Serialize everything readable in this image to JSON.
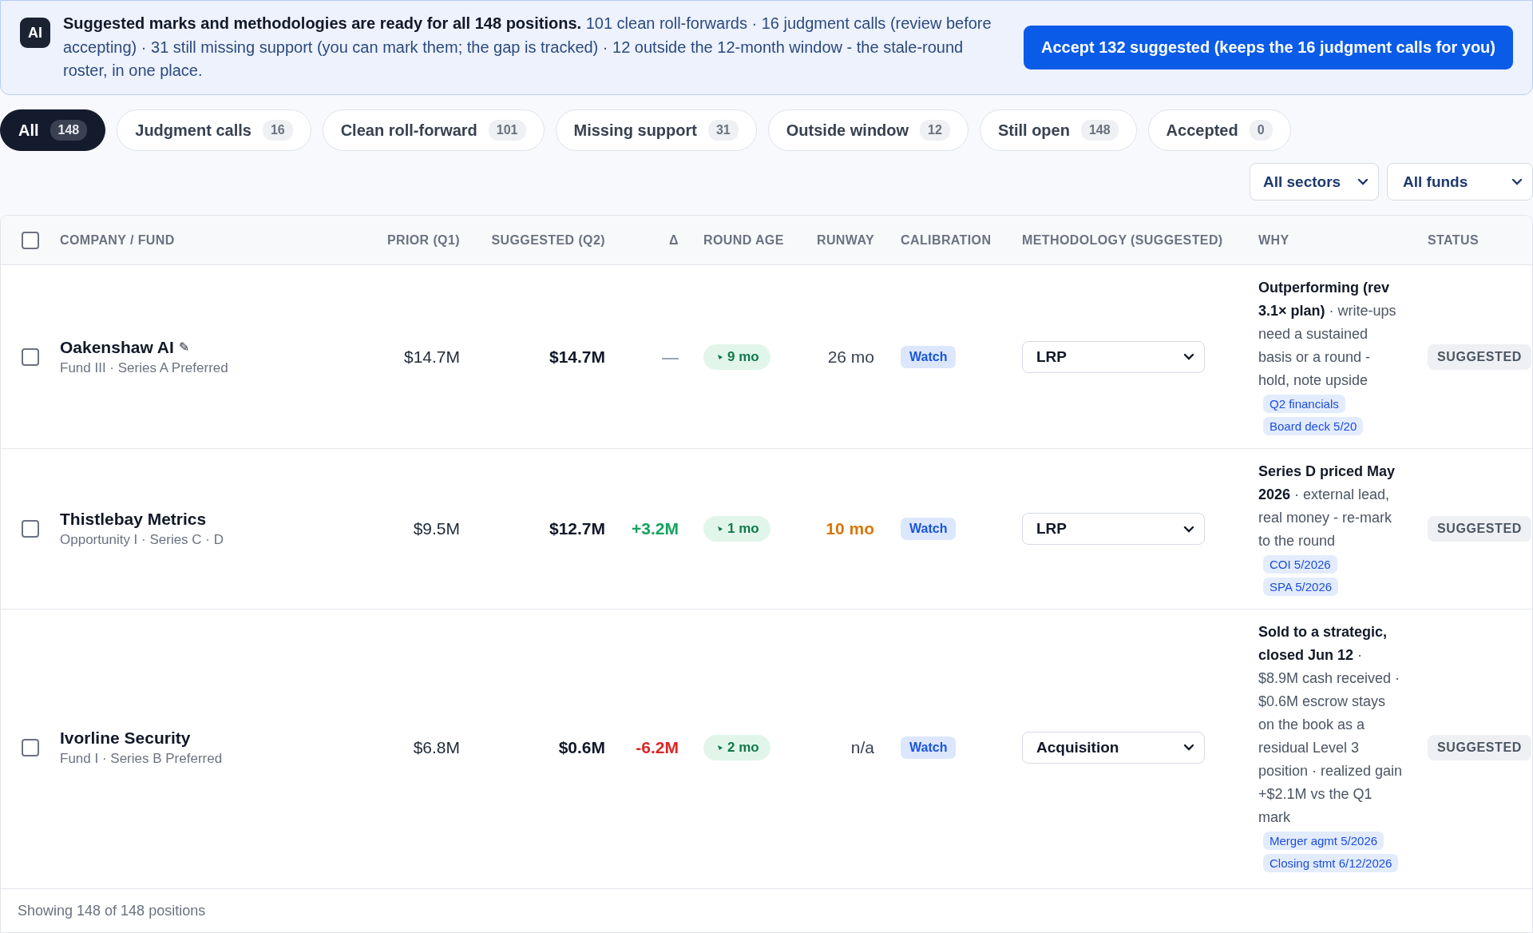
{
  "banner": {
    "badge": "AI",
    "message": "**Suggested marks and methodologies are ready for all 148 positions.** 101 clean roll-forwards · 16 judgment calls (review before accepting) · 31 still missing support (you can mark them; the gap is tracked) · 12 outside the 12-month window - the stale-round roster, in one place.",
    "action": "Accept 132 suggested (keeps the 16 judgment calls for you)"
  },
  "tabs": [
    {
      "label": "All",
      "count": "148",
      "selected": true
    },
    {
      "label": "Judgment calls",
      "count": "16",
      "selected": false
    },
    {
      "label": "Clean roll-forward",
      "count": "101",
      "selected": false
    },
    {
      "label": "Missing support",
      "count": "31",
      "selected": false
    },
    {
      "label": "Outside window",
      "count": "12",
      "selected": false
    },
    {
      "label": "Still open",
      "count": "148",
      "selected": false
    },
    {
      "label": "Accepted",
      "count": "0",
      "selected": false
    }
  ],
  "filters": [
    "All sectors",
    "All funds"
  ],
  "table": {
    "select_all_checked": false,
    "columns": [
      "COMPANY / FUND",
      "PRIOR (Q1)",
      "SUGGESTED (Q2)",
      "Δ",
      "ROUND AGE",
      "RUNWAY",
      "CALIBRATION",
      "METHODOLOGY (SUGGESTED)",
      "WHY",
      "STATUS"
    ],
    "rows": [
      {
        "checked": false,
        "name": "Oakenshaw AI",
        "edit_mark": "✎",
        "detail": "Fund III · Series A Preferred",
        "prior": "$14.7M",
        "suggested": "$14.7M",
        "delta": {
          "text": "—",
          "color": "#9ca3af"
        },
        "round_age": "9 mo",
        "runway": "26 mo",
        "runway_warning": false,
        "calibration": "Watch",
        "methodology": "LRP",
        "why": "**Outperforming (rev 3.1× plan)** · write-ups need a sustained basis or a round - hold, note upside",
        "evidence": [
          "Q2 financials",
          "Board deck 5/20"
        ],
        "status": "SUGGESTED"
      },
      {
        "checked": false,
        "name": "Thistlebay Metrics",
        "detail": "Opportunity I · Series C · D",
        "prior": "$9.5M",
        "suggested": "$12.7M",
        "delta": {
          "text": "+3.2M",
          "color": "#16a35f"
        },
        "round_age": "1 mo",
        "runway": "10 mo",
        "runway_warning": true,
        "calibration": "Watch",
        "methodology": "LRP",
        "why": "**Series D priced May 2026** · external lead, real money - re-mark to the round",
        "evidence": [
          "COI 5/2026",
          "SPA 5/2026"
        ],
        "status": "SUGGESTED"
      },
      {
        "checked": false,
        "name": "Ivorline Security",
        "detail": "Fund I · Series B Preferred",
        "prior": "$6.8M",
        "suggested": "$0.6M",
        "delta": {
          "text": "-6.2M",
          "color": "#dc2626"
        },
        "round_age": "2 mo",
        "runway": "n/a",
        "runway_warning": false,
        "calibration": "Watch",
        "methodology": "Acquisition",
        "why": "**Sold to a strategic, closed Jun 12** · $8.9M cash received · $0.6M escrow stays on the book as a residual Level 3 position · realized gain +$2.1M vs the Q1 mark",
        "evidence": [
          "Merger agmt 5/2026",
          "Closing stmt 6/12/2026"
        ],
        "status": "SUGGESTED"
      }
    ]
  },
  "footer": "Showing 148 of 148 positions"
}
